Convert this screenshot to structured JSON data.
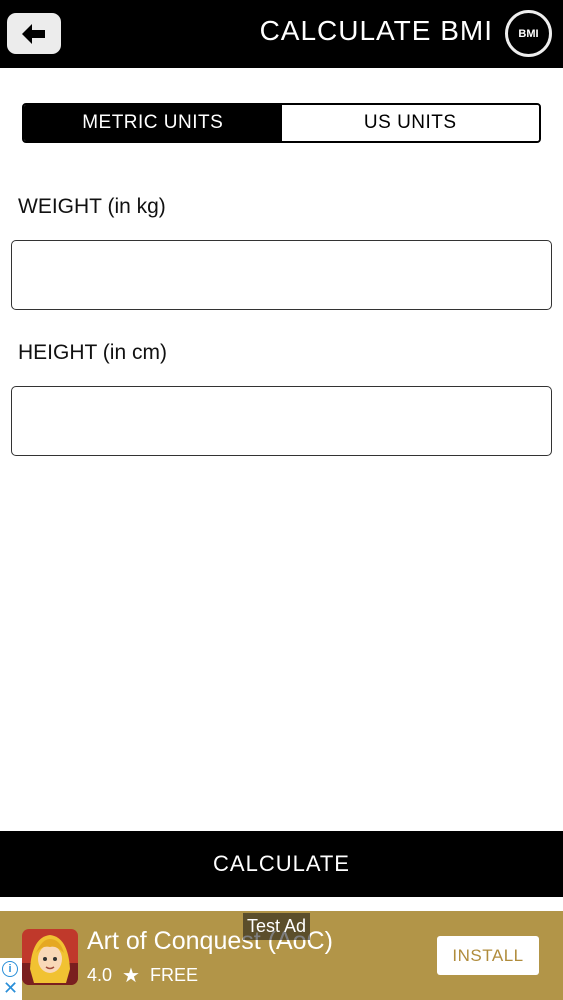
{
  "header": {
    "title": "CALCULATE BMI",
    "badge": "BMI"
  },
  "units": {
    "metric_label": "METRIC UNITS",
    "us_label": "US UNITS",
    "selected": "METRIC UNITS"
  },
  "form": {
    "weight_label": "WEIGHT (in kg)",
    "weight_value": "",
    "height_label": "HEIGHT (in cm)",
    "height_value": ""
  },
  "calculate_label": "CALCULATE",
  "ad": {
    "tag": "Test Ad",
    "title": "Art of Conquest (AoC)",
    "rating": "4.0",
    "price": "FREE",
    "install_label": "INSTALL",
    "background_color": "#b29548"
  },
  "icons": {
    "back": "back-arrow-icon",
    "star": "star-icon",
    "info": "info-icon",
    "close": "close-icon"
  }
}
